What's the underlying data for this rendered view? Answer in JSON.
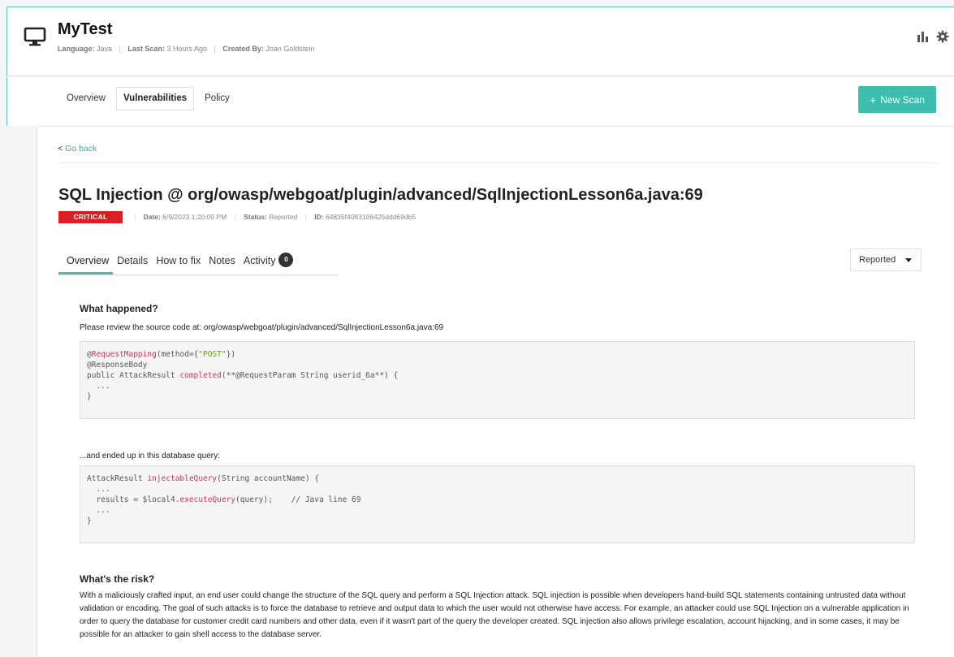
{
  "header": {
    "title": "MyTest",
    "language_label": "Language:",
    "language_value": "Java",
    "last_scan_label": "Last Scan:",
    "last_scan_value": "3 Hours Ago",
    "created_by_label": "Created By:",
    "created_by_value": "Joan Goldstein",
    "separator": "|"
  },
  "nav": {
    "tabs": [
      {
        "label": "Overview"
      },
      {
        "label": "Vulnerabilities",
        "active": true
      },
      {
        "label": "Policy"
      }
    ],
    "new_scan_label": "New Scan",
    "new_scan_plus": "+"
  },
  "finding": {
    "go_back_chevron": "<",
    "go_back": "Go back",
    "title": "SQL Injection @ org/owasp/webgoat/plugin/advanced/SqlInjectionLesson6a.java:69",
    "severity": "CRITICAL",
    "date_label": "Date:",
    "date_value": "6/9/2023 1:20:00 PM",
    "status_label": "Status:",
    "status_value": "Reported",
    "id_label": "ID:",
    "id_value": "64835f4083108425ddd69db5",
    "separator": "|",
    "tabs": [
      {
        "label": "Overview",
        "active": true
      },
      {
        "label": "Details"
      },
      {
        "label": "How to fix"
      },
      {
        "label": "Notes"
      },
      {
        "label": "Activity",
        "count": "0"
      }
    ],
    "status_dropdown": "Reported"
  },
  "overview": {
    "what_happened_heading": "What happened?",
    "review_text": "Please review the source code at: org/owasp/webgoat/plugin/advanced/SqlInjectionLesson6a.java:69",
    "source_code": [
      [
        {
          "t": "@",
          "c": ""
        },
        {
          "t": "RequestMapping",
          "c": "kw"
        },
        {
          "t": "(method={",
          "c": ""
        },
        {
          "t": "\"POST\"",
          "c": "str"
        },
        {
          "t": "})",
          "c": ""
        }
      ],
      [
        {
          "t": "@ResponseBody",
          "c": ""
        }
      ],
      [
        {
          "t": "public AttackResult ",
          "c": ""
        },
        {
          "t": "completed",
          "c": "kw"
        },
        {
          "t": "(**@RequestParam String userid_6a**) {",
          "c": ""
        }
      ],
      [
        {
          "t": "  ...",
          "c": ""
        }
      ],
      [
        {
          "t": "}",
          "c": ""
        }
      ]
    ],
    "ended_up_text": "...and ended up in this database query:",
    "query_code": [
      [
        {
          "t": "AttackResult ",
          "c": ""
        },
        {
          "t": "injectableQuery",
          "c": "kw"
        },
        {
          "t": "(String accountName) {",
          "c": ""
        }
      ],
      [
        {
          "t": "  ...",
          "c": ""
        }
      ],
      [
        {
          "t": "  results = $local4.",
          "c": ""
        },
        {
          "t": "executeQuery",
          "c": "kw"
        },
        {
          "t": "(query);    // Java line 69",
          "c": ""
        }
      ],
      [
        {
          "t": "  ...",
          "c": ""
        }
      ],
      [
        {
          "t": "}",
          "c": ""
        }
      ]
    ],
    "risk_heading": "What's the risk?",
    "risk_text": "With a maliciously crafted input, an end user could change the structure of the SQL query and perform a SQL Injection attack. SQL injection is possible when developers hand-build SQL statements containing untrusted data without validation or encoding. The goal of such attacks is to force the database to retrieve and output data to which the user would not otherwise have access. For example, an attacker could use SQL Injection on a vulnerable application in order to query the database for customer credit card numbers and other data, even if it wasn't part of the query the developer created. SQL injection also allows privilege escalation, account hijacking, and in some cases, it may be possible for an attacker to gain shell access to the database server."
  },
  "colors": {
    "accent": "#3ebfae",
    "critical": "#d81f23",
    "code_keyword": "#d23360",
    "code_string": "#6b9a1d"
  },
  "icons": {
    "app": "monitor-icon",
    "stats": "bar-chart-icon",
    "settings": "gear-icon"
  }
}
